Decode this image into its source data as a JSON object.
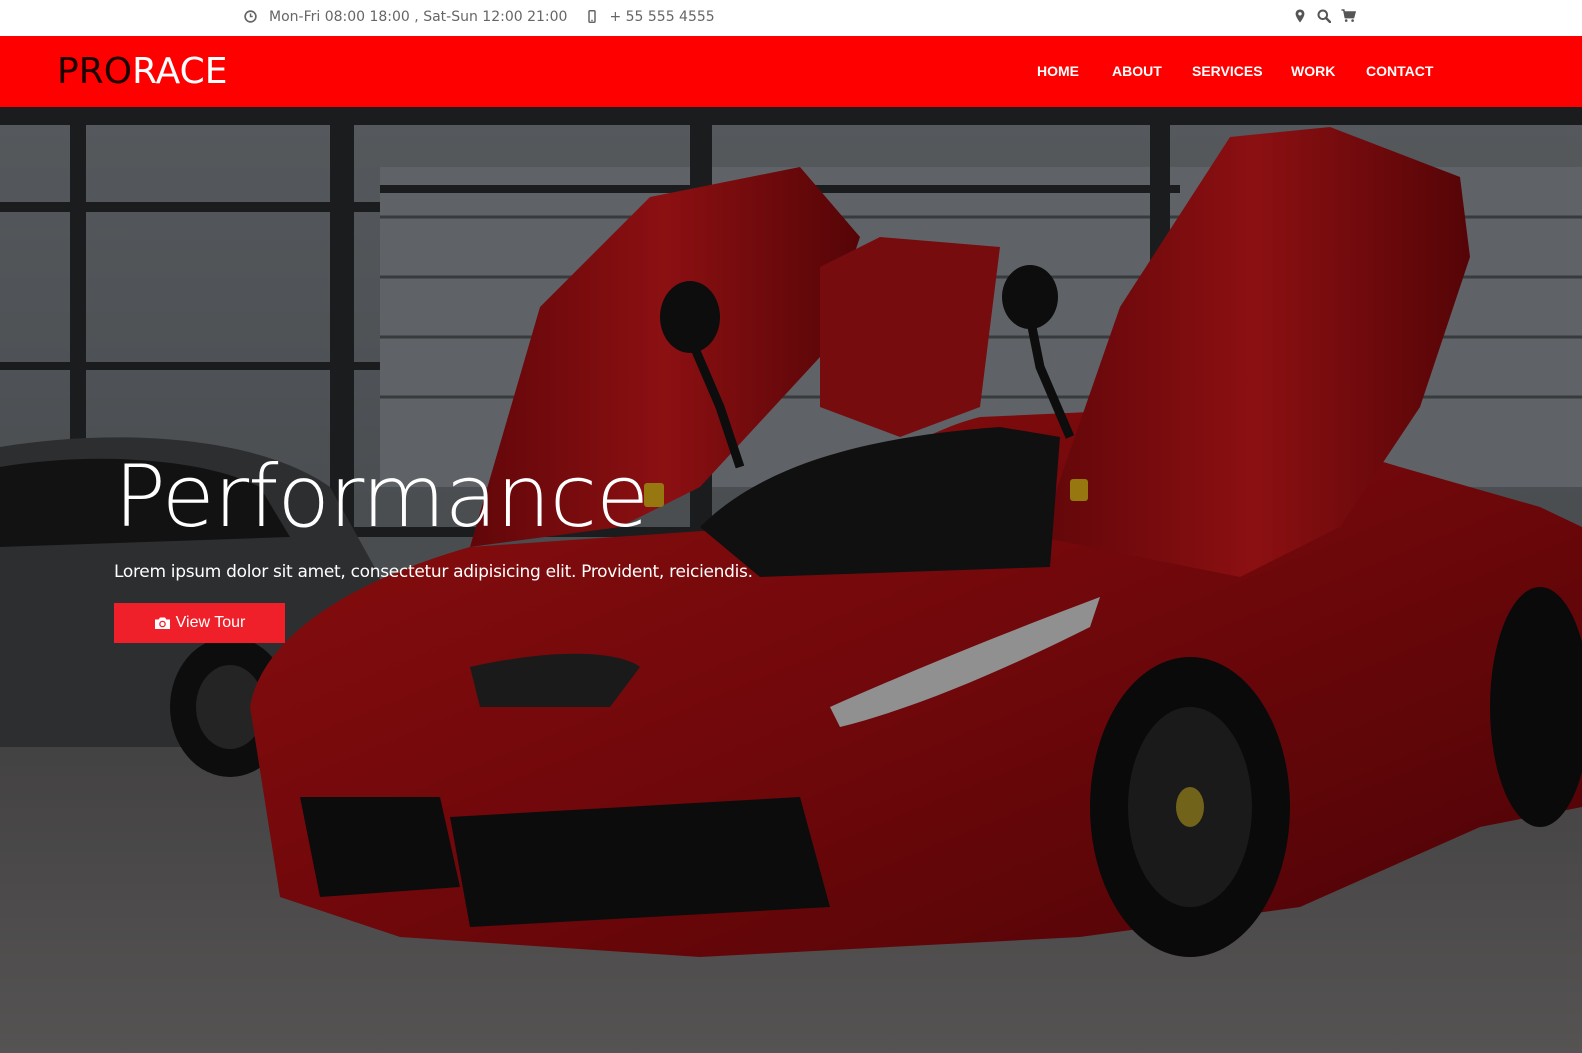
{
  "topbar": {
    "hours": "Mon-Fri 08:00 18:00 , Sat-Sun 12:00 21:00",
    "phone": "+ 55 555 4555",
    "icons": [
      "clock-icon",
      "mobile-icon",
      "map-marker-icon",
      "search-icon",
      "cart-icon"
    ]
  },
  "brand": {
    "part1": "PRO",
    "part2": "RACE"
  },
  "nav": {
    "items": [
      {
        "label": "HOME"
      },
      {
        "label": "ABOUT"
      },
      {
        "label": "SERVICES"
      },
      {
        "label": "WORK"
      },
      {
        "label": "CONTACT"
      }
    ]
  },
  "hero": {
    "title": "Performance",
    "subtitle": "Lorem ipsum dolor sit amet, consectetur adipisicing elit. Provident, reiciendis.",
    "button_label": "View Tour",
    "button_icon": "camera-icon"
  },
  "colors": {
    "nav_bg": "#ff0000",
    "brand_dark": "#1a0000",
    "button_bg": "#f0202a",
    "topbar_text": "#666666"
  }
}
